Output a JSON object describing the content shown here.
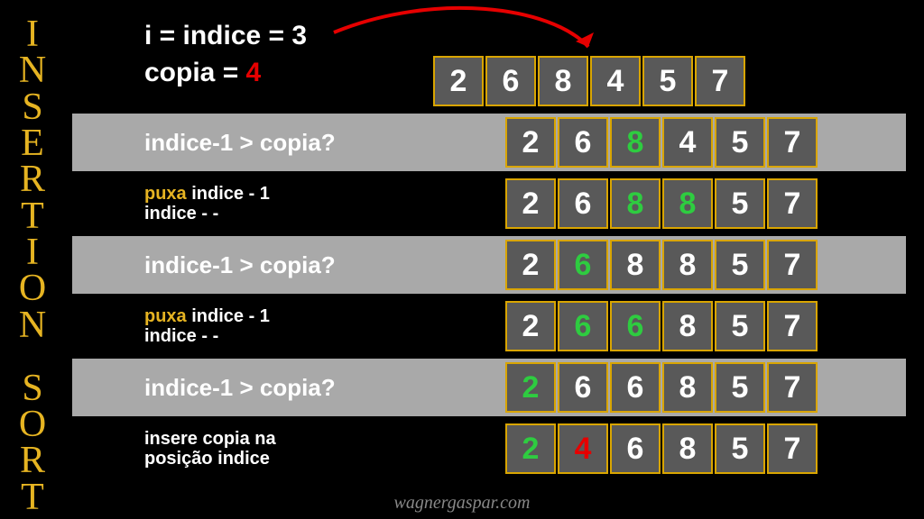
{
  "title_vertical": "INSERTION SORT",
  "top": {
    "line1": "i = indice = 3",
    "copia_label": "copia = ",
    "copia_value": "4"
  },
  "arrays": {
    "r0": [
      "2",
      "6",
      "8",
      "4",
      "5",
      "7"
    ],
    "r1": [
      "2",
      "6",
      "8",
      "4",
      "5",
      "7"
    ],
    "r2": [
      "2",
      "6",
      "8",
      "8",
      "5",
      "7"
    ],
    "r3": [
      "2",
      "6",
      "8",
      "8",
      "5",
      "7"
    ],
    "r4": [
      "2",
      "6",
      "6",
      "8",
      "5",
      "7"
    ],
    "r5": [
      "2",
      "6",
      "6",
      "8",
      "5",
      "7"
    ],
    "r6": [
      "2",
      "4",
      "6",
      "8",
      "5",
      "7"
    ]
  },
  "steps": {
    "s1": "indice-1 > copia?",
    "puxa": "puxa",
    "puxa_rest": " indice - 1",
    "puxa_line2": "indice - -",
    "insere_l1": "insere copia na",
    "insere_l2": "posição indice"
  },
  "footer": "wagnergaspar.com"
}
